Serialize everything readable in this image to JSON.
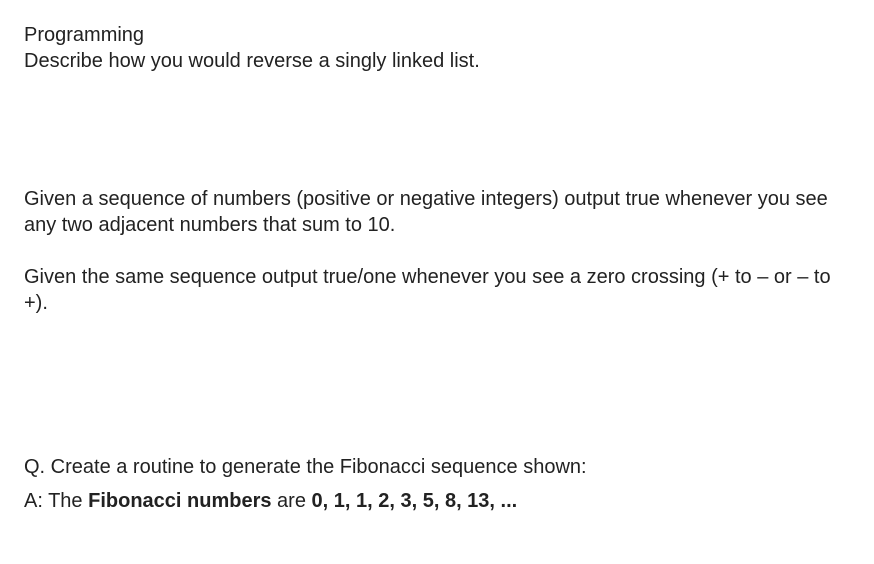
{
  "heading": "Programming",
  "q1": "Describe how you would reverse a singly linked list.",
  "q2": "Given a sequence of numbers (positive or negative integers) output true whenever you see any two adjacent numbers that sum to 10.",
  "q3": "Given the same sequence output true/one whenever you see a zero crossing (+ to – or – to +).",
  "q4": "Q. Create a routine to generate the Fibonacci sequence shown:",
  "ans_prefix": "A: The ",
  "ans_bold1": "Fibonacci numbers",
  "ans_mid": " are ",
  "ans_bold2": "0, 1, 1, 2, 3, 5, 8, 13, ..."
}
